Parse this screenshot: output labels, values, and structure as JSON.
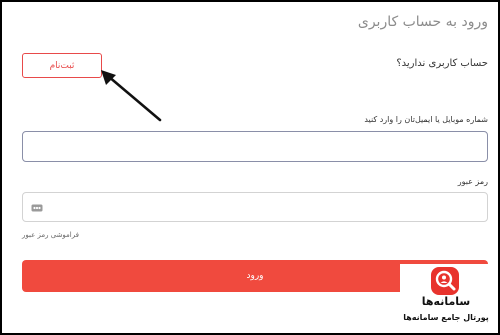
{
  "header": {
    "title": "ورود به حساب کاربری"
  },
  "signup": {
    "prompt": "حساب کاربری ندارید؟",
    "button_label": "ثبت‌نام"
  },
  "login_form": {
    "mobile_label": "شماره موبایل یا ایمیل‌تان را وارد کنید",
    "mobile_value": "",
    "password_label": "رمز عبور",
    "password_value": "",
    "password_icon": "key-icon",
    "forgot_password": "فراموشی رمز عبور",
    "submit_label": "ورود"
  },
  "watermark": {
    "brand": "سامانه‌ها",
    "tagline": "پورتال جامع سامانه‌ها",
    "icon": "search-logo-icon"
  },
  "colors": {
    "accent": "#f04a3e",
    "outline_red": "#e84a4a",
    "field_border": "#8a8fa8",
    "frame": "#000000"
  }
}
